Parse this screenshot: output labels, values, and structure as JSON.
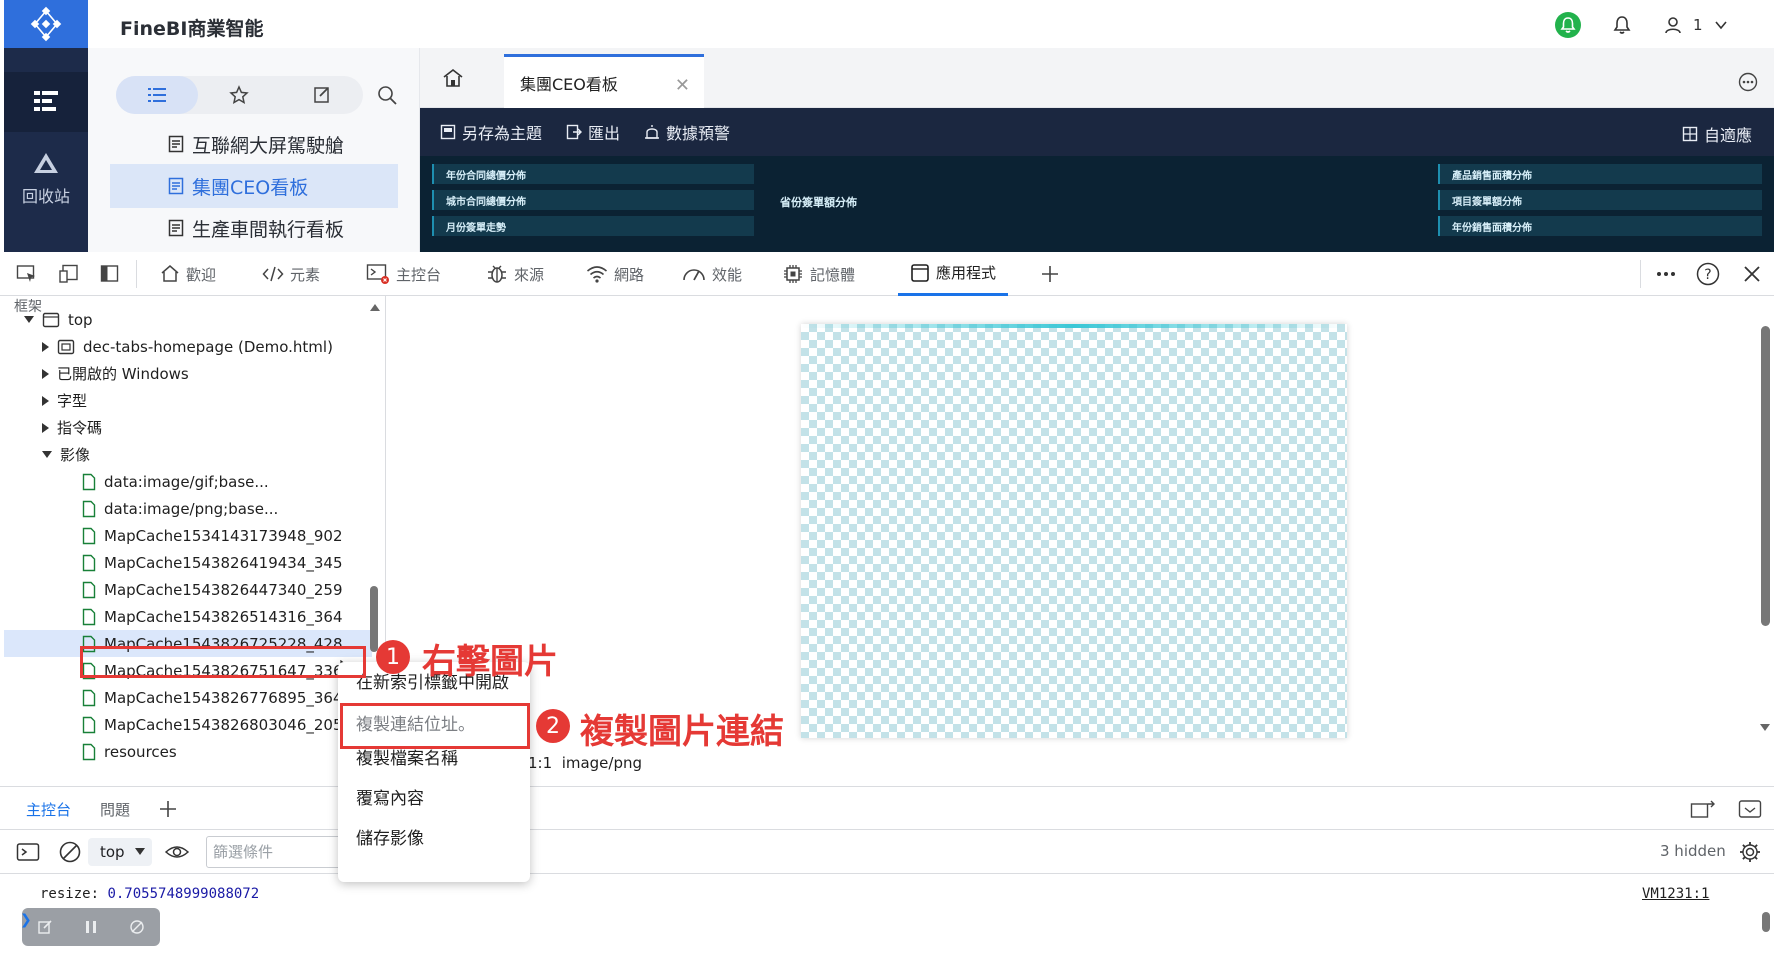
{
  "app": {
    "title": "FineBI商業智能",
    "user_name": "1"
  },
  "side_nav": {
    "recycle_label": "回收站"
  },
  "directory": {
    "items": [
      {
        "label": "互聯網大屏駕駛艙"
      },
      {
        "label": "集團CEO看板"
      },
      {
        "label": "生產車間執行看板"
      }
    ]
  },
  "tabs": {
    "active_tab": "集團CEO看板",
    "close_glyph": "✕"
  },
  "toolbar": {
    "save_theme": "另存為主題",
    "export": "匯出",
    "alert": "數據預警",
    "fit": "自適應"
  },
  "dashboard": {
    "left_titles": [
      "年份合同總價分佈",
      "城市合同總價分佈",
      "月份簽單走勢"
    ],
    "middle_title": "省份簽單額分佈",
    "right_titles": [
      "產品銷售面積分佈",
      "項目簽單額分佈",
      "年份銷售面積分佈"
    ]
  },
  "devtools": {
    "tabs": [
      "歡迎",
      "元素",
      "主控台",
      "來源",
      "網路",
      "效能",
      "記憶體",
      "應用程式"
    ],
    "active_tab": "應用程式",
    "help_glyph": "?",
    "tree": {
      "header": "框架",
      "top": "top",
      "items": [
        "dec-tabs-homepage (Demo.html)",
        "已開啟的 Windows",
        "字型",
        "指令碼",
        "影像",
        "data:image/gif;base...",
        "data:image/png;base...",
        "MapCache1534143173948_902",
        "MapCache1543826419434_345",
        "MapCache1543826447340_259",
        "MapCache1543826514316_364",
        "MapCache1543826725228_428",
        "MapCache1543826751647_336",
        "MapCache1543826776895_364",
        "MapCache1543826803046_205",
        "resources"
      ],
      "selected_index": 11
    },
    "image_info": {
      "ratio": "1:1",
      "mime": "image/png"
    },
    "drawer": {
      "tabs": [
        "主控台",
        "問題"
      ],
      "active": "主控台"
    },
    "console": {
      "context": "top",
      "filter_placeholder": "篩選條件",
      "hidden": "3 hidden",
      "log_prefix": "resize: ",
      "log_value": "0.7055748999088072",
      "log_source": "VM1231:1"
    },
    "context_menu": {
      "items": [
        "在新索引標籤中開啟",
        "複製連結位址。",
        "複製檔案名稱",
        "覆寫內容",
        "儲存影像"
      ]
    }
  },
  "annotations": {
    "step1_number": "1",
    "step1_text": "右擊圖片",
    "step2_number": "2",
    "step2_text": "複製圖片連結"
  },
  "colors": {
    "accent": "#2f6fdc",
    "devtools_blue": "#1a73e8",
    "annotation_red": "#e53935",
    "dark_toolbar": "#1b2740",
    "notify_green": "#22b24c"
  }
}
